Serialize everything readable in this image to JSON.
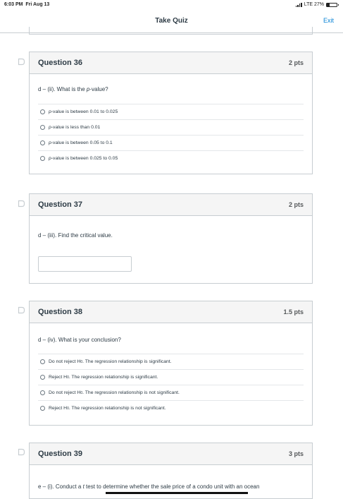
{
  "status": {
    "time": "6:03 PM",
    "date": "Fri Aug 13",
    "network": "LTE 27%",
    "battery_level": 0.27
  },
  "nav": {
    "title": "Take Quiz",
    "exit_label": "Exit"
  },
  "questions": [
    {
      "title": "Question 36",
      "points": "2 pts",
      "prompt_pre": "d – (ii). What is the ",
      "prompt_italic": "p",
      "prompt_post": "-value?",
      "answers": [
        {
          "italic": "p",
          "rest": "-value is between 0.01 to 0.025"
        },
        {
          "italic": "p",
          "rest": "-value is less than 0.01"
        },
        {
          "italic": "p",
          "rest": "-value is between 0.05 to 0.1"
        },
        {
          "italic": "p",
          "rest": "-value is between 0.025 to 0.05"
        }
      ]
    },
    {
      "title": "Question 37",
      "points": "2 pts",
      "prompt": "d – (iii). Find the critical value.",
      "input_value": ""
    },
    {
      "title": "Question 38",
      "points": "1.5 pts",
      "prompt": "d – (iv). What is your conclusion?",
      "answers": [
        {
          "lead": "Do not reject H",
          "sub": "0",
          "rest": ". The regression relationship is significant."
        },
        {
          "lead": "Reject H",
          "sub": "0",
          "rest": ". The regression relationship is significant."
        },
        {
          "lead": "Do not reject H",
          "sub": "0",
          "rest": ". The regression relationship is not significant."
        },
        {
          "lead": "Reject H",
          "sub": "0",
          "rest": ". The regression relationship is not significant."
        }
      ]
    },
    {
      "title": "Question 39",
      "points": "3 pts",
      "prompt_pre": "e – (i). Conduct a ",
      "prompt_italic": "t",
      "prompt_post": " test to determine whether the sale price of a condo unit with an ocean"
    }
  ],
  "colors": {
    "accent": "#0b84d6",
    "border": "#c7cdd1",
    "header_bg": "#f5f5f5",
    "text": "#2d3b45"
  }
}
